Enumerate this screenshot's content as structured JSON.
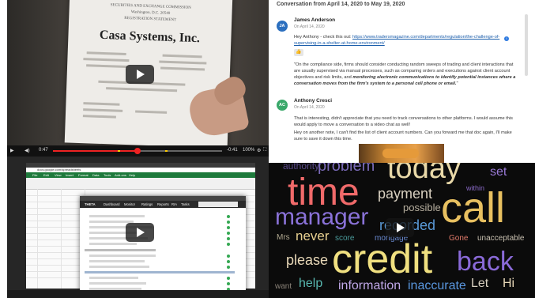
{
  "video": {
    "doc_line1": "SECURITIES AND EXCHANGE COMMISSION",
    "doc_line2": "Washington, D.C. 20549",
    "doc_line3": "REGISTRATION STATEMENT",
    "company": "Casa Systems, Inc.",
    "time_current": "0:47",
    "time_remaining": "-0:41",
    "zoom": "100%",
    "progress_fraction": 0.5
  },
  "conversation": {
    "header": "Conversation from April 14, 2020 to May 19, 2020",
    "messages": [
      {
        "initials": "JA",
        "name": "James Anderson",
        "date": "On April 14, 2020",
        "intro": "Hey Anthony - check this out: ",
        "link": "https://www.tradersmagazine.com/departments/regulation/the-challenge-of-supervising-in-a-shelter-at-home-environment/",
        "quote_a": "\"On the compliance side, firms should consider conducting random sweeps of trading and client interactions that are usually supervised via manual processes, such as comparing orders and executions against client account objectives and risk limits, and ",
        "quote_b": "monitoring electronic communications to identify potential instances where a conversation moves from the firm's system to a personal cell phone or email.",
        "quote_c": "\"",
        "color": "#2b6fbf"
      },
      {
        "initials": "AC",
        "name": "Anthony Cresci",
        "date": "On April 14, 2020",
        "text1": "That is interesting, didn't appreciate that you need to track conversations to other platforms. I would assume this would apply to move a conversation to a video chat as well!",
        "text2": "Hey on another note, I can't find the list of client account numbers. Can you forward me that doc again, I'll make sure to save it down this time.",
        "color": "#3aa86a"
      }
    ]
  },
  "screen_recording": {
    "url": "docs.google.com/spreadsheets",
    "menu_items": [
      "File",
      "Edit",
      "View",
      "Insert",
      "Format",
      "Data",
      "Tools",
      "Add-ons",
      "Help"
    ],
    "window_nav": [
      "THETA",
      "Dashboard",
      "Monitor",
      "Ratings",
      "Reports",
      "RIA",
      "Tasks"
    ]
  },
  "word_cloud": {
    "words": [
      {
        "text": "authority",
        "color": "#5a4a8a"
      },
      {
        "text": "problem",
        "color": "#7a6ab8"
      },
      {
        "text": "today",
        "color": "#e8d8a8"
      },
      {
        "text": "set",
        "color": "#9a7ad8"
      },
      {
        "text": "time",
        "color": "#f06a6a"
      },
      {
        "text": "payment",
        "color": "#d8d0c0"
      },
      {
        "text": "within",
        "color": "#8a6ac8"
      },
      {
        "text": "possible",
        "color": "#b8b0a0"
      },
      {
        "text": "call",
        "color": "#e8c060"
      },
      {
        "text": "manager",
        "color": "#8a72d8"
      },
      {
        "text": "recorded",
        "color": "#5a9ad8"
      },
      {
        "text": "Mrs",
        "color": "#b0a890"
      },
      {
        "text": "never",
        "color": "#e8d090"
      },
      {
        "text": "score",
        "color": "#4a9a9a"
      },
      {
        "text": "mortgage",
        "color": "#6a8ad0"
      },
      {
        "text": "Gone",
        "color": "#e07a6a"
      },
      {
        "text": "unacceptable",
        "color": "#c8c0b0"
      },
      {
        "text": "please",
        "color": "#e8d8b8"
      },
      {
        "text": "credit",
        "color": "#f0e080"
      },
      {
        "text": "back",
        "color": "#8a6ad8"
      },
      {
        "text": "want",
        "color": "#8a8278"
      },
      {
        "text": "help",
        "color": "#58b8b0"
      },
      {
        "text": "information",
        "color": "#c0a8e8"
      },
      {
        "text": "inaccurate",
        "color": "#5a98e0"
      },
      {
        "text": "Let",
        "color": "#d8d0c0"
      },
      {
        "text": "Hi",
        "color": "#e8d8b8"
      }
    ]
  }
}
